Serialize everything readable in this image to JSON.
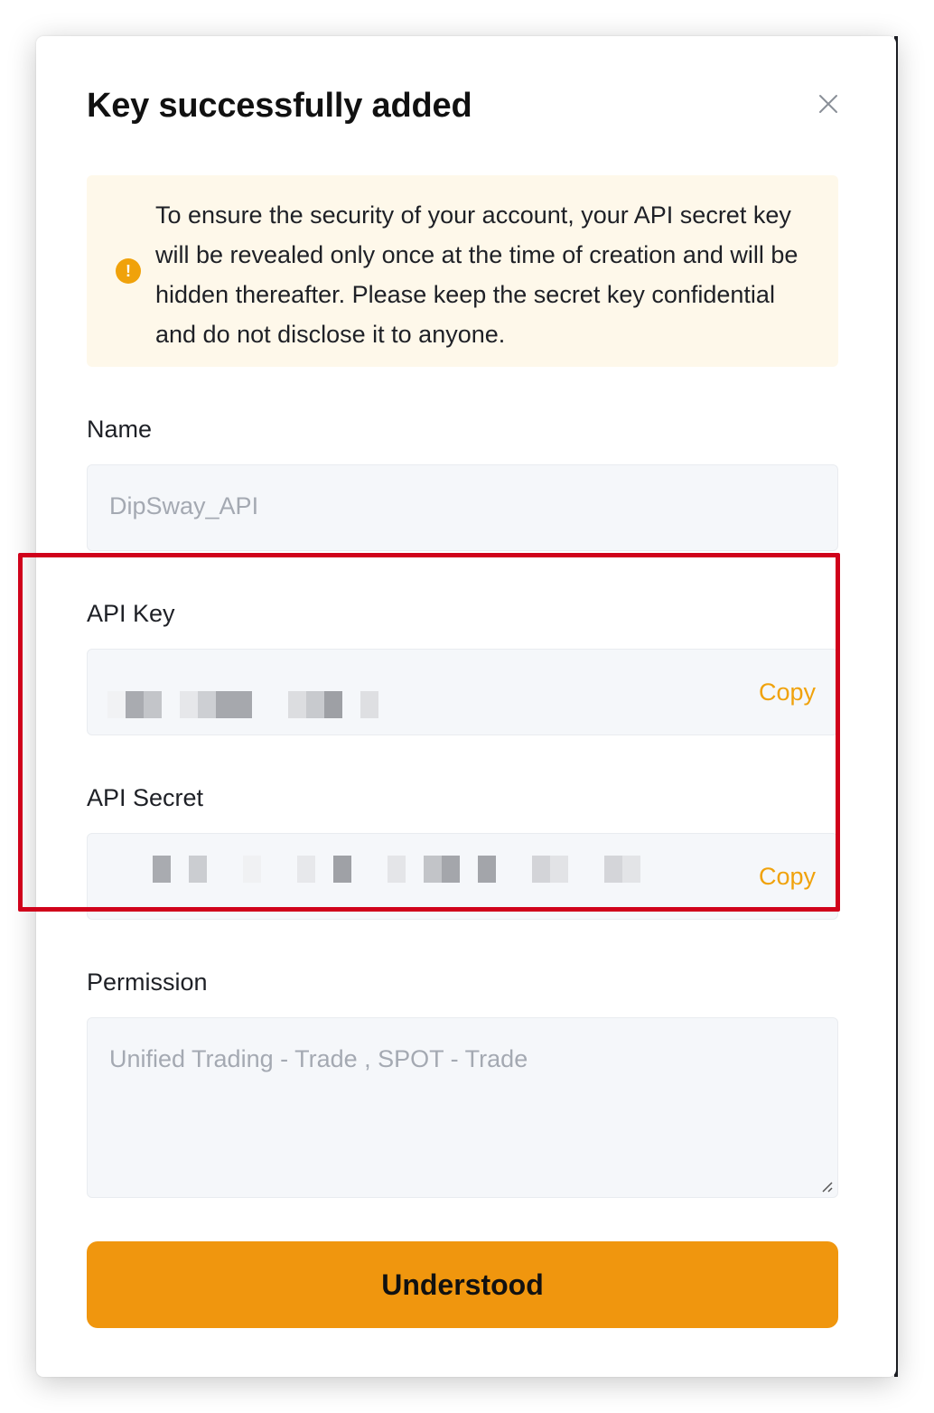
{
  "modal": {
    "title": "Key successfully added",
    "notice": {
      "icon": "warning-icon",
      "text": "To ensure the security of your account, your API secret key will be revealed only once at the time of creation and will be hidden thereafter. Please keep the secret key confidential and do not disclose it to anyone."
    },
    "fields": {
      "name": {
        "label": "Name",
        "value": "DipSway_API"
      },
      "api_key": {
        "label": "API Key",
        "copy_label": "Copy"
      },
      "api_secret": {
        "label": "API Secret",
        "copy_label": "Copy"
      },
      "permission": {
        "label": "Permission",
        "value": "Unified Trading - Trade  , SPOT - Trade"
      }
    },
    "primary_button": "Understood"
  },
  "colors": {
    "accent": "#f0a20b",
    "button": "#f0960e",
    "highlight_border": "#d0021b",
    "notice_bg": "#fef8ea"
  }
}
